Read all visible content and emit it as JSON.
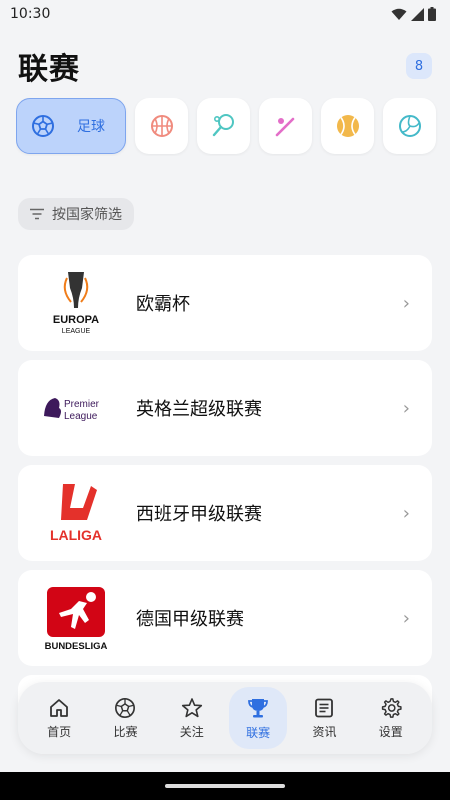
{
  "status": {
    "time": "10:30"
  },
  "header": {
    "title": "联赛",
    "badge": "8"
  },
  "sports": [
    {
      "name": "soccer",
      "label": "足球",
      "icon": "soccer-ball-icon",
      "color": "#2f6fe0",
      "active": true
    },
    {
      "name": "basketball",
      "icon": "basketball-icon",
      "color": "#f08b7e"
    },
    {
      "name": "tennis",
      "icon": "tennis-racket-icon",
      "color": "#4fc6c2"
    },
    {
      "name": "badminton",
      "icon": "badminton-icon",
      "color": "#e36ec8"
    },
    {
      "name": "tennis-ball",
      "icon": "tennis-ball-icon",
      "color": "#f2b84b"
    },
    {
      "name": "volleyball",
      "icon": "volleyball-icon",
      "color": "#44b9c9"
    }
  ],
  "filter": {
    "label": "按国家筛选"
  },
  "leagues": [
    {
      "name": "欧霸杯",
      "logo_text": [
        "EUROPA",
        "LEAGUE"
      ]
    },
    {
      "name": "英格兰超级联赛",
      "logo_text": [
        "Premier",
        "League"
      ]
    },
    {
      "name": "西班牙甲级联赛",
      "logo_text": [
        "LALIGA"
      ]
    },
    {
      "name": "德国甲级联赛",
      "logo_text": [
        "BUNDESLIGA"
      ]
    }
  ],
  "tabs": [
    {
      "label": "首页",
      "icon": "home-icon"
    },
    {
      "label": "比赛",
      "icon": "soccer-ball-icon"
    },
    {
      "label": "关注",
      "icon": "star-icon"
    },
    {
      "label": "联赛",
      "icon": "trophy-icon",
      "active": true
    },
    {
      "label": "资讯",
      "icon": "news-icon"
    },
    {
      "label": "设置",
      "icon": "gear-icon"
    }
  ],
  "colors": {
    "accent": "#2f6fe0",
    "background": "#f3f4f6",
    "laliga_red": "#e4312b",
    "bundesliga_red": "#d20515",
    "premier_purple": "#3d195b"
  }
}
